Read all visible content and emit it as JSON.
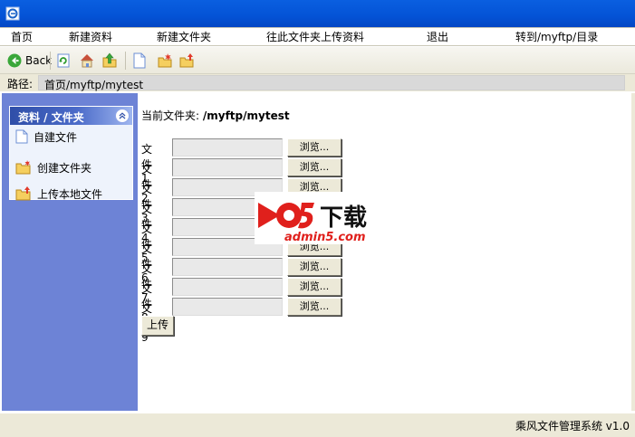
{
  "menu": {
    "items": [
      {
        "label": "首页"
      },
      {
        "label": "新建资料"
      },
      {
        "label": "新建文件夹"
      },
      {
        "label": "往此文件夹上传资料"
      },
      {
        "label": "退出"
      },
      {
        "label": "转到/myftp/目录"
      }
    ]
  },
  "toolbar": {
    "back_label": "Back",
    "icons": [
      "back-icon",
      "refresh-icon",
      "home-icon",
      "up-folder-icon",
      "new-file-icon",
      "new-folder-icon",
      "upload-folder-icon"
    ]
  },
  "path": {
    "label": "路径:",
    "value": "首页/myftp/mytest"
  },
  "sidebar": {
    "title": "资料 / 文件夹",
    "items": [
      {
        "label": "自建文件",
        "icon": "new-file-icon"
      },
      {
        "label": "创建文件夹",
        "icon": "new-folder-icon"
      },
      {
        "label": "上传本地文件",
        "icon": "upload-folder-icon"
      }
    ]
  },
  "main": {
    "current_folder_label": "当前文件夹:",
    "current_folder_value": "/myftp/mytest",
    "browse_label": "浏览...",
    "files": [
      {
        "label": "文件1"
      },
      {
        "label": "文件2"
      },
      {
        "label": "文件3"
      },
      {
        "label": "文件4"
      },
      {
        "label": "文件5"
      },
      {
        "label": "文件6"
      },
      {
        "label": "文件7"
      },
      {
        "label": "文件8"
      },
      {
        "label": "文件9"
      }
    ],
    "upload_label": "上传"
  },
  "watermark": {
    "title": "下载",
    "site": "admin5.com"
  },
  "status": {
    "text": "乘风文件管理系统 v1.0"
  },
  "colors": {
    "titlebar": "#0453d6",
    "sidebar": "#6d83d6",
    "watermark_red": "#e0201c"
  }
}
